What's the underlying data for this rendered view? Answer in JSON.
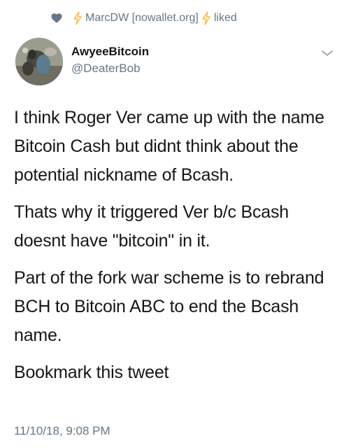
{
  "social_context": {
    "prefix_icon": "heart-icon",
    "bolt_icon": "lightning-bolt-icon",
    "user_label": "MarcDW [nowallet.org]",
    "action_label": "liked",
    "accent_color": "#f5b946"
  },
  "tweet": {
    "author": {
      "display_name": "AwyeeBitcoin",
      "handle": "@DeaterBob"
    },
    "menu_icon": "chevron-down-icon",
    "paragraphs": [
      "I think Roger Ver came up with the name Bitcoin Cash but didnt think about the potential nickname of Bcash.",
      "Thats why it triggered Ver b/c Bcash doesnt have \"bitcoin\" in it.",
      "Part of the fork war scheme is to rebrand BCH to Bitcoin ABC to end the Bcash name.",
      "Bookmark this tweet"
    ],
    "timestamp": "11/10/18, 9:08 PM"
  },
  "colors": {
    "text": "#14171a",
    "secondary": "#657786"
  }
}
